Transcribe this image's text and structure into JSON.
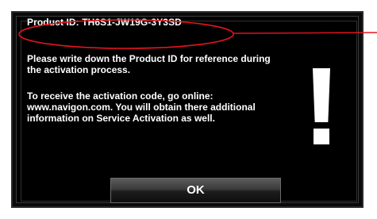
{
  "dialog": {
    "product_id_text": "Product ID: TH6S1-JW19G-3Y3SD",
    "paragraph_1": "Please write down the Product ID for reference during the activation process.",
    "paragraph_2": "To receive the activation code, go online: www.navigon.com. You will obtain there additional information on Service Activation as well.",
    "ok_label": "OK"
  },
  "colors": {
    "dialog_background": "#000000",
    "text": "#ffffff",
    "highlight_annotation": "#e4141e",
    "page_background": "#ffffff"
  },
  "icons": {
    "warning": "exclamation-mark-icon"
  }
}
